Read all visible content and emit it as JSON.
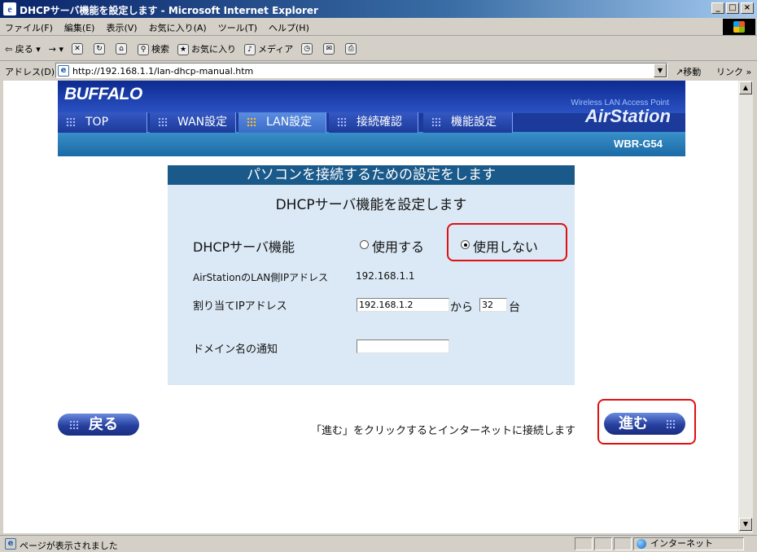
{
  "window": {
    "title": "DHCPサーバ機能を設定します - Microsoft Internet Explorer",
    "buttons": {
      "minimize": "_",
      "maximize": "□",
      "close": "×"
    }
  },
  "menu": [
    "ファイル(F)",
    "編集(E)",
    "表示(V)",
    "お気に入り(A)",
    "ツール(T)",
    "ヘルプ(H)"
  ],
  "toolbar": {
    "back": "戻る",
    "forward": "→",
    "search": "検索",
    "favorites": "お気に入り",
    "media": "メディア"
  },
  "address": {
    "label": "アドレス(D)",
    "url": "http://192.168.1.1/lan-dhcp-manual.htm",
    "go": "移動",
    "links": "リンク"
  },
  "banner": {
    "logo": "BUFFALO",
    "tagline": "Wireless LAN Access Point",
    "product": "AirStation",
    "model": "WBR-G54"
  },
  "tabs": [
    {
      "label": "TOP",
      "active": false
    },
    {
      "label": "WAN設定",
      "active": false
    },
    {
      "label": "LAN設定",
      "active": true
    },
    {
      "label": "接続確認",
      "active": false
    },
    {
      "label": "機能設定",
      "active": false
    }
  ],
  "panel": {
    "header": "パソコンを接続するための設定をします",
    "subtitle": "DHCPサーバ機能を設定します",
    "dhcp_label": "DHCPサーバ機能",
    "option_use": "使用する",
    "option_nouse": "使用しない",
    "selected": "使用しない",
    "lan_ip_label": "AirStationのLAN側IPアドレス",
    "lan_ip_value": "192.168.1.1",
    "assign_label": "割り当てIPアドレス",
    "assign_start": "192.168.1.2",
    "from_text": "から",
    "assign_count": "32",
    "unit_text": "台",
    "domain_label": "ドメイン名の通知",
    "domain_value": ""
  },
  "nav": {
    "back_label": "戻る",
    "next_label": "進む",
    "notice": "「進む」をクリックするとインターネットに接続します"
  },
  "status": {
    "text": "ページが表示されました",
    "zone": "インターネット"
  },
  "colors": {
    "banner_blue": "#1b3a9a",
    "panel_header": "#1a5a8a",
    "panel_bg": "#dbe9f6",
    "highlight_red": "#e01010",
    "active_tab_dots": "#ffc020"
  }
}
